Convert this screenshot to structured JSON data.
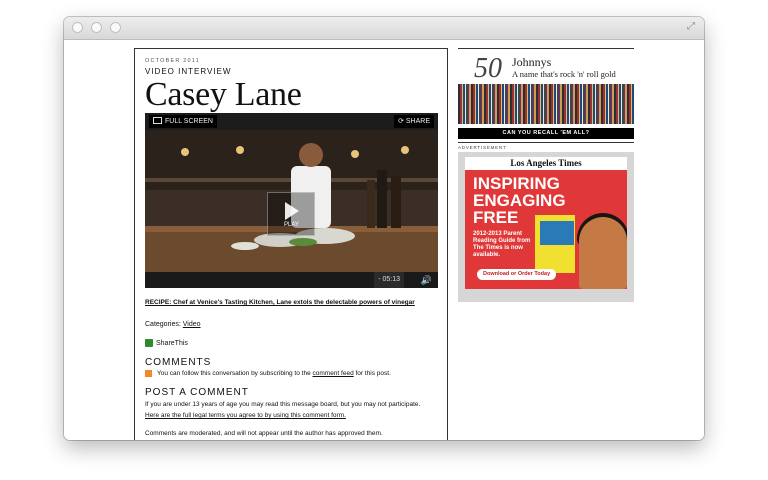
{
  "article": {
    "date": "OCTOBER 2011",
    "section": "VIDEO INTERVIEW",
    "headline": "Casey Lane"
  },
  "player": {
    "fullscreen_label": "FULL SCREEN",
    "share_label": "SHARE",
    "play_label": "PLAY",
    "time": "- 05:13",
    "volume_icon": "speaker-icon"
  },
  "links": {
    "recipe": "RECIPE: Chef at Venice's Tasting Kitchen, Lane extols the delectable powers of vinegar",
    "categories_label": "Categories:",
    "category": "Video",
    "share_this": "ShareThis"
  },
  "comments": {
    "title": "COMMENTS",
    "follow_text": "You can follow this conversation by subscribing to the",
    "feed_link": "comment feed",
    "follow_suffix": "for this post.",
    "post_title": "POST A COMMENT",
    "age_notice": "If you are under 13 years of age you may read this message board, but you may not participate.",
    "legal_link": "Here are the full legal terms you agree to by using this comment form.",
    "moderation": "Comments are moderated, and will not appear until the author has approved them."
  },
  "sidebar": {
    "johnnys_number": "50",
    "johnnys_name": "Johnnys",
    "johnnys_tagline": "A name that's rock 'n' roll gold",
    "recall_button": "CAN YOU RECALL 'EM ALL?",
    "ad_label": "ADVERTISEMENT"
  },
  "ad": {
    "brand": "Los Angeles Times",
    "line1": "INSPIRING",
    "line2": "ENGAGING",
    "line3": "FREE",
    "sub": "2012-2013 Parent Reading Guide from The Times is now available.",
    "cta": "Download or Order Today"
  }
}
